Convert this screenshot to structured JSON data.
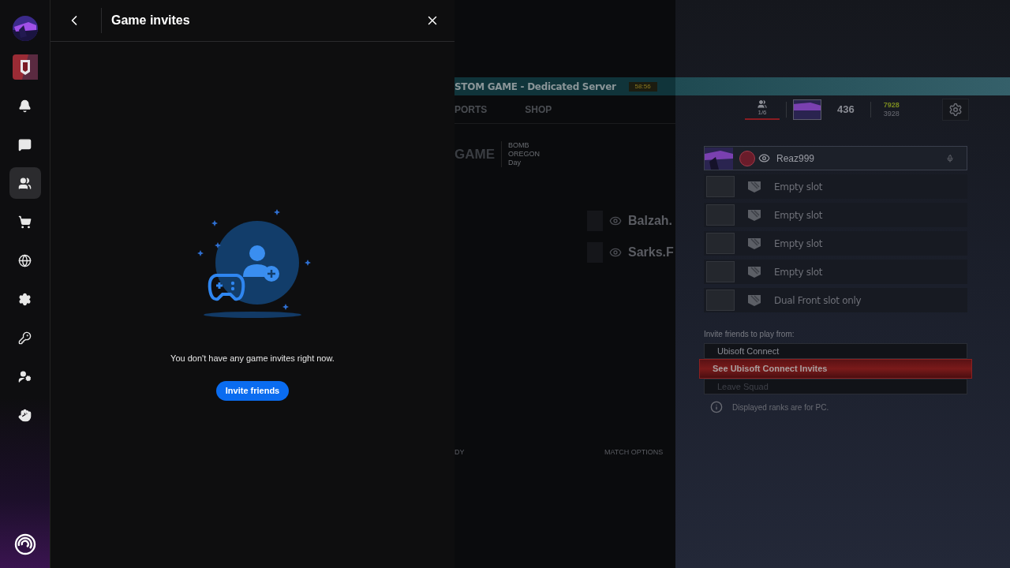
{
  "sidebar": {
    "items": [
      {
        "kind": "avatar",
        "selected": false
      },
      {
        "kind": "game",
        "selected": false
      },
      {
        "kind": "bell",
        "selected": false
      },
      {
        "kind": "chat",
        "selected": false
      },
      {
        "kind": "friends",
        "selected": true
      },
      {
        "kind": "cart",
        "selected": false
      },
      {
        "kind": "globe",
        "selected": false
      },
      {
        "kind": "gear",
        "selected": false
      },
      {
        "kind": "key",
        "selected": false
      },
      {
        "kind": "user-gear",
        "selected": false
      },
      {
        "kind": "hand",
        "selected": false
      }
    ]
  },
  "panel": {
    "title": "Game invites",
    "empty_message": "You don't have any game invites right now.",
    "button": "Invite friends"
  },
  "game": {
    "header_title": "STOM GAME - Dedicated Server",
    "timer": "58:56",
    "nav": [
      "PORTS",
      "SHOP"
    ],
    "mode_title": "GAME",
    "mode_details": [
      "BOMB",
      "OREGON",
      "Day"
    ],
    "players": [
      "Balzah.",
      "Sarks.F"
    ],
    "footer": [
      "DY",
      "MATCH OPTIONS"
    ],
    "squad": {
      "count": "1/6",
      "rank": "436",
      "currency_1": "7928",
      "currency_2": "3928",
      "members": [
        {
          "kind": "player",
          "name": "Reaz999"
        },
        {
          "kind": "empty",
          "name": "Empty slot"
        },
        {
          "kind": "empty",
          "name": "Empty slot"
        },
        {
          "kind": "empty",
          "name": "Empty slot"
        },
        {
          "kind": "empty",
          "name": "Empty slot"
        },
        {
          "kind": "empty",
          "name": "Dual Front slot only"
        }
      ],
      "invite_label": "Invite friends to play from:",
      "options": [
        {
          "label": "Ubisoft Connect",
          "selected": false,
          "disabled": false
        },
        {
          "label": "See Ubisoft Connect Invites",
          "selected": true,
          "disabled": false
        },
        {
          "label": "Leave Squad",
          "selected": false,
          "disabled": true
        }
      ],
      "note": "Displayed ranks are for PC."
    }
  }
}
